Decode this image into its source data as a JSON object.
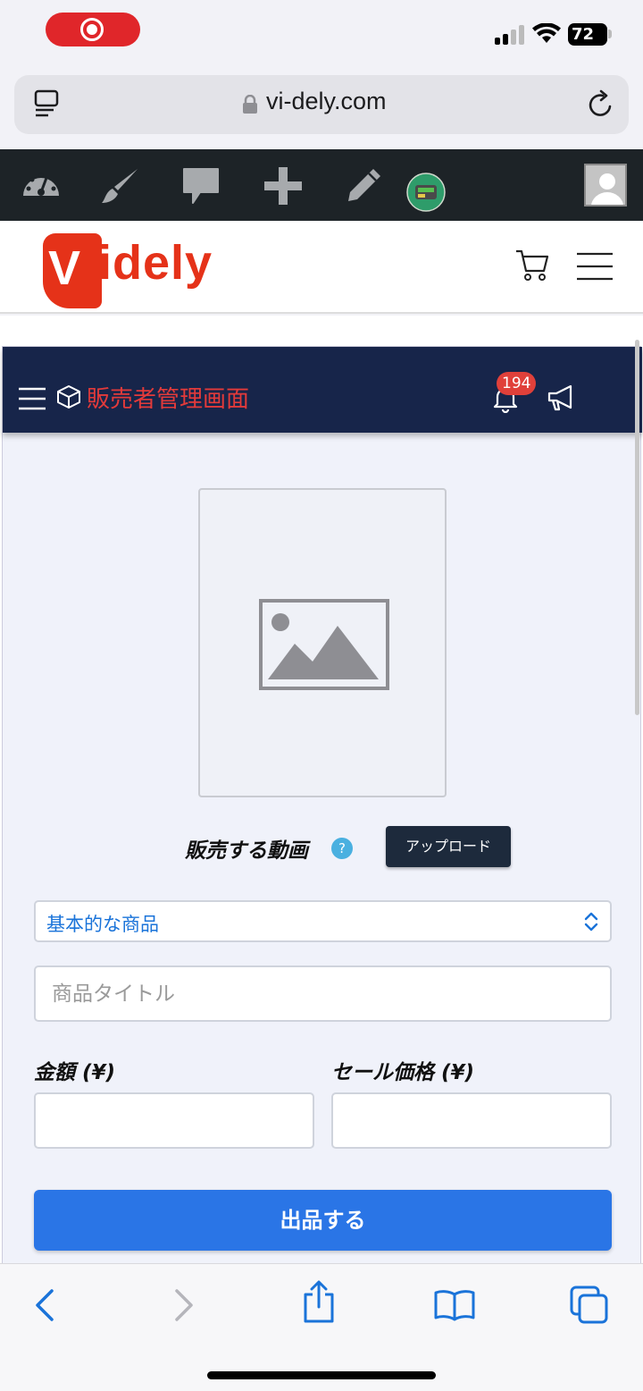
{
  "status_bar": {
    "battery": "72"
  },
  "browser": {
    "url": "vi-dely.com"
  },
  "wp_admin_bar": {
    "icons": [
      "dashboard-icon",
      "customize-brush-icon",
      "comments-icon",
      "new-plus-icon",
      "edit-pencil-icon",
      "plugin-badge-icon",
      "user-avatar-icon"
    ]
  },
  "site": {
    "logo_letter": "V",
    "logo_text": "idely"
  },
  "seller_panel": {
    "title": "販売者管理画面",
    "notification_count": "194",
    "video_label": "販売する動画",
    "help_mark": "?",
    "upload_button": "アップロード",
    "product_type_selected": "基本的な商品",
    "title_placeholder": "商品タイトル",
    "price_label": "金額 (¥)",
    "sale_price_label": "セール価格 (¥)",
    "submit_button": "出品する"
  },
  "colors": {
    "brand_red": "#e53219",
    "panel_nav": "#17254a",
    "primary_button": "#2a75e6",
    "title_red": "#e33a3a"
  }
}
